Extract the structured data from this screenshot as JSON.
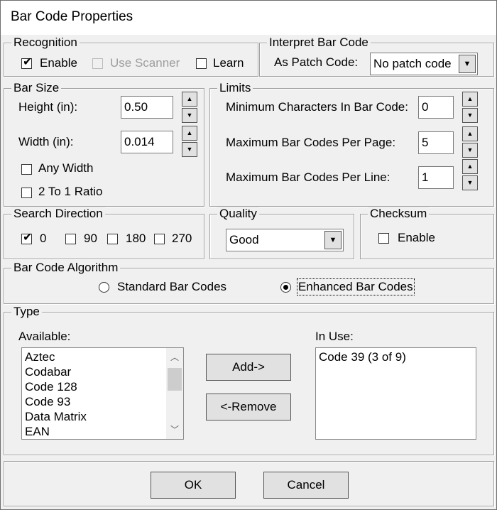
{
  "window": {
    "title": "Bar Code Properties"
  },
  "recognition": {
    "legend": "Recognition",
    "enable": {
      "label": "Enable",
      "checked": true
    },
    "use_scanner": {
      "label": "Use Scanner",
      "checked": false,
      "enabled": false
    },
    "learn": {
      "label": "Learn",
      "checked": false
    }
  },
  "interpret": {
    "legend": "Interpret Bar Code",
    "patch_label": "As Patch Code:",
    "patch_value": "No patch code"
  },
  "bar_size": {
    "legend": "Bar Size",
    "height_label": "Height (in):",
    "height_value": "0.50",
    "width_label": "Width (in):",
    "width_value": "0.014",
    "any_width": {
      "label": "Any Width",
      "checked": false
    },
    "two_to_one": {
      "label": "2 To 1 Ratio",
      "checked": false
    }
  },
  "limits": {
    "legend": "Limits",
    "min_chars_label": "Minimum Characters In Bar Code:",
    "min_chars_value": "0",
    "max_page_label": "Maximum Bar Codes Per Page:",
    "max_page_value": "5",
    "max_line_label": "Maximum Bar Codes Per Line:",
    "max_line_value": "1"
  },
  "search_direction": {
    "legend": "Search Direction",
    "options": [
      {
        "label": "0",
        "checked": true
      },
      {
        "label": "90",
        "checked": false
      },
      {
        "label": "180",
        "checked": false
      },
      {
        "label": "270",
        "checked": false
      }
    ]
  },
  "quality": {
    "legend": "Quality",
    "value": "Good"
  },
  "checksum": {
    "legend": "Checksum",
    "enable": {
      "label": "Enable",
      "checked": false
    }
  },
  "algorithm": {
    "legend": "Bar Code Algorithm",
    "standard": {
      "label": "Standard Bar Codes",
      "selected": false
    },
    "enhanced": {
      "label": "Enhanced Bar Codes",
      "selected": true
    }
  },
  "type": {
    "legend": "Type",
    "available_label": "Available:",
    "available": [
      "Aztec",
      "Codabar",
      "Code 128",
      "Code 93",
      "Data Matrix",
      "EAN"
    ],
    "in_use_label": "In Use:",
    "in_use": [
      "Code 39 (3 of 9)"
    ],
    "add_label": "Add->",
    "remove_label": "<-Remove"
  },
  "buttons": {
    "ok": "OK",
    "cancel": "Cancel"
  },
  "icons": {
    "check": "✔",
    "up": "▲",
    "down": "▼",
    "scroll_up": "︿",
    "scroll_down": "﹀"
  }
}
